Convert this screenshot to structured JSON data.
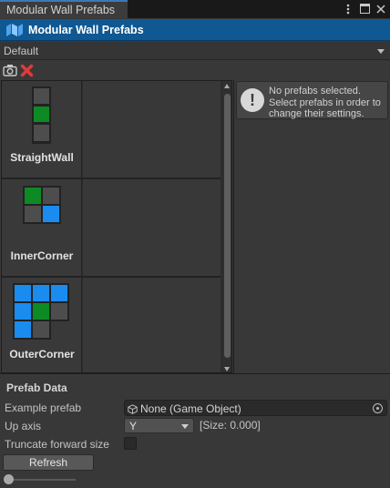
{
  "window": {
    "tab_title": "Modular Wall Prefabs",
    "header_title": "Modular Wall Prefabs"
  },
  "palette": {
    "selected": "Default"
  },
  "prefabs": [
    {
      "name": "StraightWall"
    },
    {
      "name": "InnerCorner"
    },
    {
      "name": "OuterCorner"
    }
  ],
  "info": {
    "message": "No prefabs selected. Select prefabs in order to change their settings."
  },
  "prefab_data": {
    "section_title": "Prefab Data",
    "example_prefab_label": "Example prefab",
    "example_prefab_value": "None (Game Object)",
    "up_axis_label": "Up axis",
    "up_axis_value": "Y",
    "size_info": "[Size: 0.000]",
    "truncate_label": "Truncate forward size",
    "refresh_label": "Refresh"
  },
  "colors": {
    "header_bg": "#0f5892",
    "tile_green": "#0e8a25",
    "tile_blue": "#1a8cf0",
    "tile_gray": "#4d4d4d"
  }
}
